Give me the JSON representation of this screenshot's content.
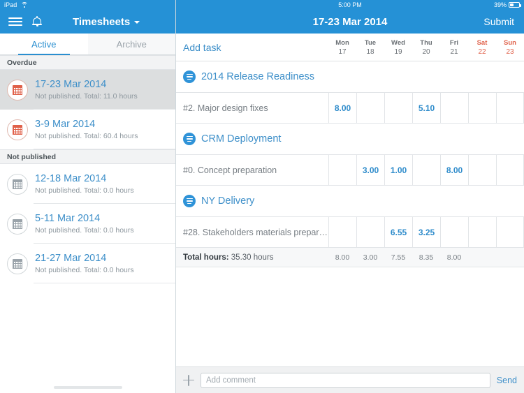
{
  "status_bar": {
    "device": "iPad",
    "wifi_icon": "wifi-icon",
    "time": "5:00 PM",
    "battery_pct": "39%",
    "battery_icon": "battery-icon"
  },
  "sidebar": {
    "menu_icon": "hamburger-menu-icon",
    "bell_icon": "bell-icon",
    "title": "Timesheets",
    "chevron_icon": "chevron-down-icon",
    "tabs": [
      {
        "label": "Active",
        "active": true
      },
      {
        "label": "Archive",
        "active": false
      }
    ],
    "sections": [
      {
        "label": "Overdue",
        "icon_style": "overdue",
        "items": [
          {
            "title": "17-23 Mar 2014",
            "subtitle": "Not published. Total: 11.0 hours",
            "selected": true,
            "icon": "calendar-icon"
          },
          {
            "title": "3-9 Mar 2014",
            "subtitle": "Not published. Total: 60.4 hours",
            "selected": false,
            "icon": "calendar-icon"
          }
        ]
      },
      {
        "label": "Not published",
        "icon_style": "normal",
        "items": [
          {
            "title": "12-18 Mar 2014",
            "subtitle": "Not published. Total: 0.0 hours",
            "selected": false,
            "icon": "calendar-icon"
          },
          {
            "title": "5-11 Mar 2014",
            "subtitle": "Not published. Total: 0.0 hours",
            "selected": false,
            "icon": "calendar-icon"
          },
          {
            "title": "21-27 Mar 2014",
            "subtitle": "Not published. Total: 0.0 hours",
            "selected": false,
            "icon": "calendar-icon"
          }
        ]
      }
    ]
  },
  "main": {
    "title": "17-23 Mar 2014",
    "submit_label": "Submit",
    "add_task_label": "Add task",
    "days": [
      {
        "name": "Mon",
        "num": "17",
        "weekend": false
      },
      {
        "name": "Tue",
        "num": "18",
        "weekend": false
      },
      {
        "name": "Wed",
        "num": "19",
        "weekend": false
      },
      {
        "name": "Thu",
        "num": "20",
        "weekend": false
      },
      {
        "name": "Fri",
        "num": "21",
        "weekend": false
      },
      {
        "name": "Sat",
        "num": "22",
        "weekend": true
      },
      {
        "name": "Sun",
        "num": "23",
        "weekend": true
      }
    ],
    "projects": [
      {
        "name": "2014 Release Readiness",
        "icon": "project-list-icon",
        "tasks": [
          {
            "name": "#2. Major design fixes",
            "values": [
              "8.00",
              "",
              "",
              "5.10",
              "",
              "",
              ""
            ]
          }
        ]
      },
      {
        "name": "CRM Deployment",
        "icon": "project-list-icon",
        "tasks": [
          {
            "name": "#0. Concept preparation",
            "values": [
              "",
              "3.00",
              "1.00",
              "",
              "8.00",
              "",
              ""
            ]
          }
        ]
      },
      {
        "name": "NY Delivery",
        "icon": "project-list-icon",
        "tasks": [
          {
            "name": "#28. Stakeholders materials prepar…",
            "values": [
              "",
              "",
              "6.55",
              "3.25",
              "",
              "",
              ""
            ]
          }
        ]
      }
    ],
    "total_row": {
      "label_bold": "Total hours:",
      "label_rest": " 35.30 hours",
      "daily": [
        "8.00",
        "3.00",
        "7.55",
        "8.35",
        "8.00",
        "",
        ""
      ]
    },
    "comment_bar": {
      "add_icon": "plus-icon",
      "placeholder": "Add comment",
      "value": "",
      "send_label": "Send"
    }
  },
  "colors": {
    "brand_blue": "#2591d6",
    "link_blue": "#3d8fc9",
    "weekend_red": "#e0614a",
    "selected_row": "#dcdedf"
  }
}
